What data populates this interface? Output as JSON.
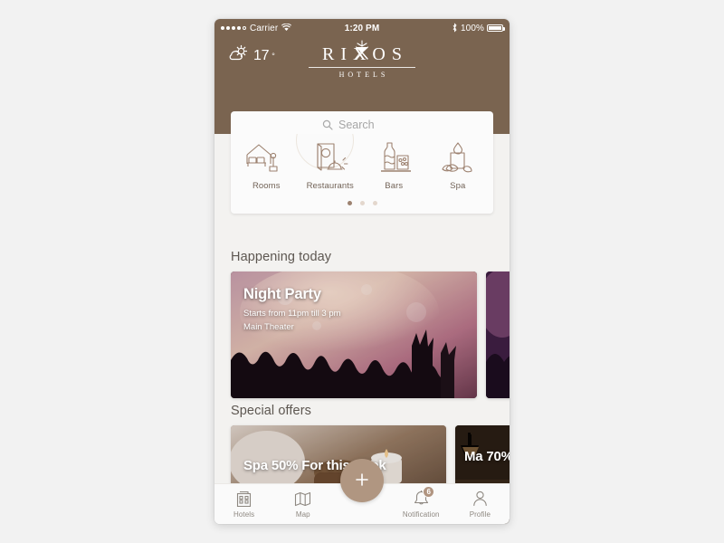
{
  "status_bar": {
    "carrier": "Carrier",
    "time": "1:20 PM",
    "battery_percent": "100%",
    "signal_icon": "signal-dots-icon",
    "wifi_icon": "wifi-icon",
    "bluetooth_icon": "bluetooth-icon",
    "battery_icon": "battery-icon"
  },
  "header": {
    "weather": {
      "temperature": "17",
      "degree": "°",
      "icon": "sun-behind-cloud-icon"
    },
    "logo": {
      "wordmark": "RIXOS",
      "subtitle": "HOTELS",
      "crown_icon": "crown-x-icon"
    },
    "bg_color": "#7a6450"
  },
  "search": {
    "placeholder": "Search",
    "value": "",
    "icon": "search-icon"
  },
  "categories": {
    "items": [
      {
        "label": "Rooms",
        "icon": "bed-room-icon"
      },
      {
        "label": "Restaurants",
        "icon": "menu-cloche-icon"
      },
      {
        "label": "Bars",
        "icon": "bottle-glass-icon"
      },
      {
        "label": "Spa",
        "icon": "candle-lotus-icon"
      }
    ],
    "pager": {
      "count": 3,
      "active_index": 0
    }
  },
  "happening": {
    "title": "Happening today",
    "cards": [
      {
        "title": "Night Party",
        "time": "Starts from 11pm till 3 pm",
        "venue": "Main Theater"
      }
    ]
  },
  "offers": {
    "title": "Special offers",
    "cards": [
      {
        "text": "Spa 50% For this week"
      },
      {
        "text": "Ma\n70%"
      }
    ]
  },
  "tab_bar": {
    "items": [
      {
        "label": "Hotels",
        "icon": "building-icon"
      },
      {
        "label": "Map",
        "icon": "map-icon"
      },
      {
        "label": "Notification",
        "icon": "bell-icon",
        "badge": "6"
      },
      {
        "label": "Profile",
        "icon": "person-icon"
      }
    ],
    "fab": {
      "label": "+",
      "icon": "plus-icon",
      "color": "#b09681"
    }
  }
}
